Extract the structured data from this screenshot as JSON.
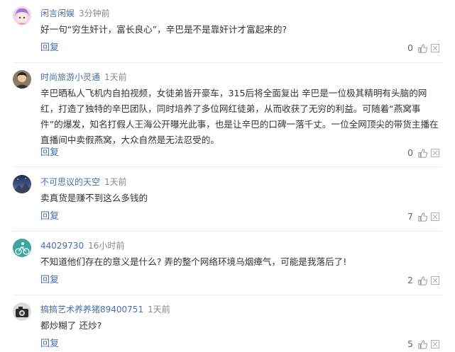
{
  "comments": [
    {
      "username": "闲言闲娱",
      "time": "3分钟前",
      "text": "好一句“穷生奸计，富长良心”，辛巴是不是靠奸计才富起来的?",
      "reply_label": "回复",
      "likes": "0",
      "avatar_icon": "anime-avatar-icon"
    },
    {
      "username": "时尚旅游小灵通",
      "time": "1天前",
      "text": "辛巴晒私人飞机内自拍视频，女徒弟皆开豪车，315后将全面复出 辛巴是一位极其精明有头脑的网红，打造了独特的辛巴团队，同时培养了多位网红徒弟，从而收获了无穷的利益。可随着“燕窝事件”的爆发，知名打假人王海公开曝光此事，也是让辛巴的口碑一落千丈。一位全网顶尖的带货主播在直播间中卖假燕窝，大众自然是无法忍受的。",
      "reply_label": "回复",
      "likes": "0",
      "avatar_icon": "portrait-avatar-icon"
    },
    {
      "username": "不可思议的天空",
      "time": "1天前",
      "text": "卖真货是赚不到这么多钱的",
      "reply_label": "回复",
      "likes": "7",
      "avatar_icon": "sky-avatar-icon"
    },
    {
      "username": "44029730",
      "time": "16小时前",
      "text": "不知道他们存在的意义是什么? 弄的整个网络环境乌烟瘴气，可能是我落后了!",
      "reply_label": "回复",
      "likes": "2",
      "avatar_icon": "cyclist-avatar-icon"
    },
    {
      "username": "搞搞艺术养养猪89400751",
      "time": "1天前",
      "text": "都炒糊了 还炒?",
      "reply_label": "回复",
      "likes": "5",
      "avatar_icon": "camera-avatar-icon"
    }
  ],
  "icons": {
    "like": "thumbs-up-icon",
    "more": "more-options-icon"
  },
  "colors": {
    "username": "#4a6fa8",
    "text": "#333333",
    "meta": "#888888",
    "divider": "#ececec"
  }
}
